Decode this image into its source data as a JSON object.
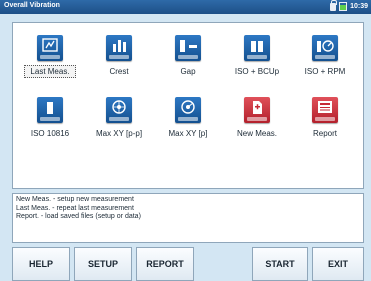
{
  "titlebar": {
    "title": "Overall Vibration",
    "time": "10:39"
  },
  "tiles": [
    {
      "label": "Last Meas.",
      "icon": "last-measurement-icon",
      "color": "blue"
    },
    {
      "label": "Crest",
      "icon": "crest-icon",
      "color": "blue"
    },
    {
      "label": "Gap",
      "icon": "gap-icon",
      "color": "blue"
    },
    {
      "label": "ISO + BCUp",
      "icon": "iso-bcup-icon",
      "color": "blue"
    },
    {
      "label": "ISO + RPM",
      "icon": "iso-rpm-icon",
      "color": "blue"
    },
    {
      "label": "ISO 10816",
      "icon": "iso-10816-icon",
      "color": "blue"
    },
    {
      "label": "Max XY [p-p]",
      "icon": "max-xy-pp-icon",
      "color": "blue"
    },
    {
      "label": "Max XY [p]",
      "icon": "max-xy-p-icon",
      "color": "blue"
    },
    {
      "label": "New Meas.",
      "icon": "new-measurement-icon",
      "color": "red"
    },
    {
      "label": "Report",
      "icon": "report-icon",
      "color": "red"
    }
  ],
  "help": [
    "New Meas. - setup new measurement",
    "Last Meas. - repeat last measurement",
    "Report. - load saved files (setup or data)"
  ],
  "softkeys": {
    "help": "HELP",
    "setup": "SETUP",
    "report": "REPORT",
    "start": "START",
    "exit": "EXIT"
  }
}
